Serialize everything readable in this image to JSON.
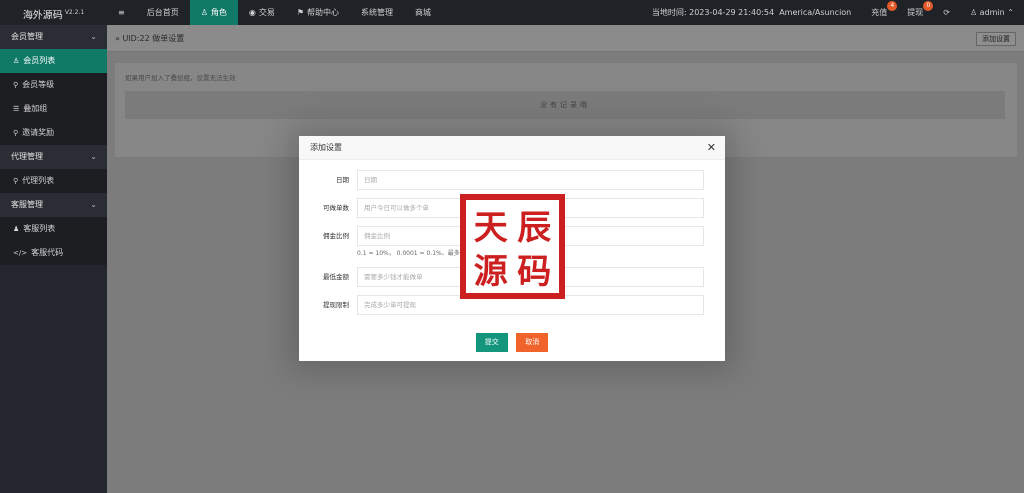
{
  "app": {
    "logo": "海外源码",
    "version": "V2.2.1"
  },
  "topnav": {
    "menu_icon": "≡",
    "items": [
      {
        "label": "后台首页",
        "icon": ""
      },
      {
        "label": "角色",
        "icon": "♙",
        "active": true
      },
      {
        "label": "交易",
        "icon": "◉"
      },
      {
        "label": "帮助中心",
        "icon": "⚑"
      },
      {
        "label": "系统管理",
        "icon": ""
      },
      {
        "label": "商城",
        "icon": ""
      }
    ],
    "time_label": "当地时间: 2023-04-29 21:40:54",
    "timezone": "America/Asuncion",
    "recharge": {
      "label": "充值",
      "badge": "4"
    },
    "withdraw": {
      "label": "提现",
      "badge": "0"
    },
    "refresh_icon": "⟳",
    "user": {
      "icon": "♙",
      "name": "admin",
      "caret": "⌃"
    }
  },
  "sidebar": {
    "groups": [
      {
        "label": "会员管理",
        "items": [
          {
            "label": "会员列表",
            "icon": "♙",
            "active": true
          },
          {
            "label": "会员等级",
            "icon": "⚲"
          },
          {
            "label": "叠加组",
            "icon": "☰"
          },
          {
            "label": "邀请奖励",
            "icon": "⚲"
          }
        ]
      },
      {
        "label": "代理管理",
        "items": [
          {
            "label": "代理列表",
            "icon": "⚲"
          }
        ]
      },
      {
        "label": "客服管理",
        "items": [
          {
            "label": "客服列表",
            "icon": "♟"
          },
          {
            "label": "客服代码",
            "icon": "</>"
          }
        ]
      }
    ]
  },
  "main": {
    "breadcrumb": "» UID:22 做单设置",
    "add_button": "添加设置",
    "hint": "如果用户加入了叠加组，设置无法生效",
    "empty": "没有记录哦"
  },
  "modal": {
    "title": "添加设置",
    "fields": [
      {
        "label": "日期",
        "placeholder": "日期"
      },
      {
        "label": "可做单数",
        "placeholder": "用户今日可以做多个单"
      },
      {
        "label": "佣金比例",
        "placeholder": "佣金比例"
      },
      {
        "label": "最低金额",
        "placeholder": "需要多少钱才能做单"
      },
      {
        "label": "提现限制",
        "placeholder": "完成多少单可提现"
      }
    ],
    "help": "0.1 = 10%， 0.0001 = 0.1%、最多可设置6位小数",
    "submit": "提交",
    "cancel": "取消"
  },
  "stamp": {
    "chars": [
      "天",
      "辰",
      "源",
      "码"
    ]
  }
}
